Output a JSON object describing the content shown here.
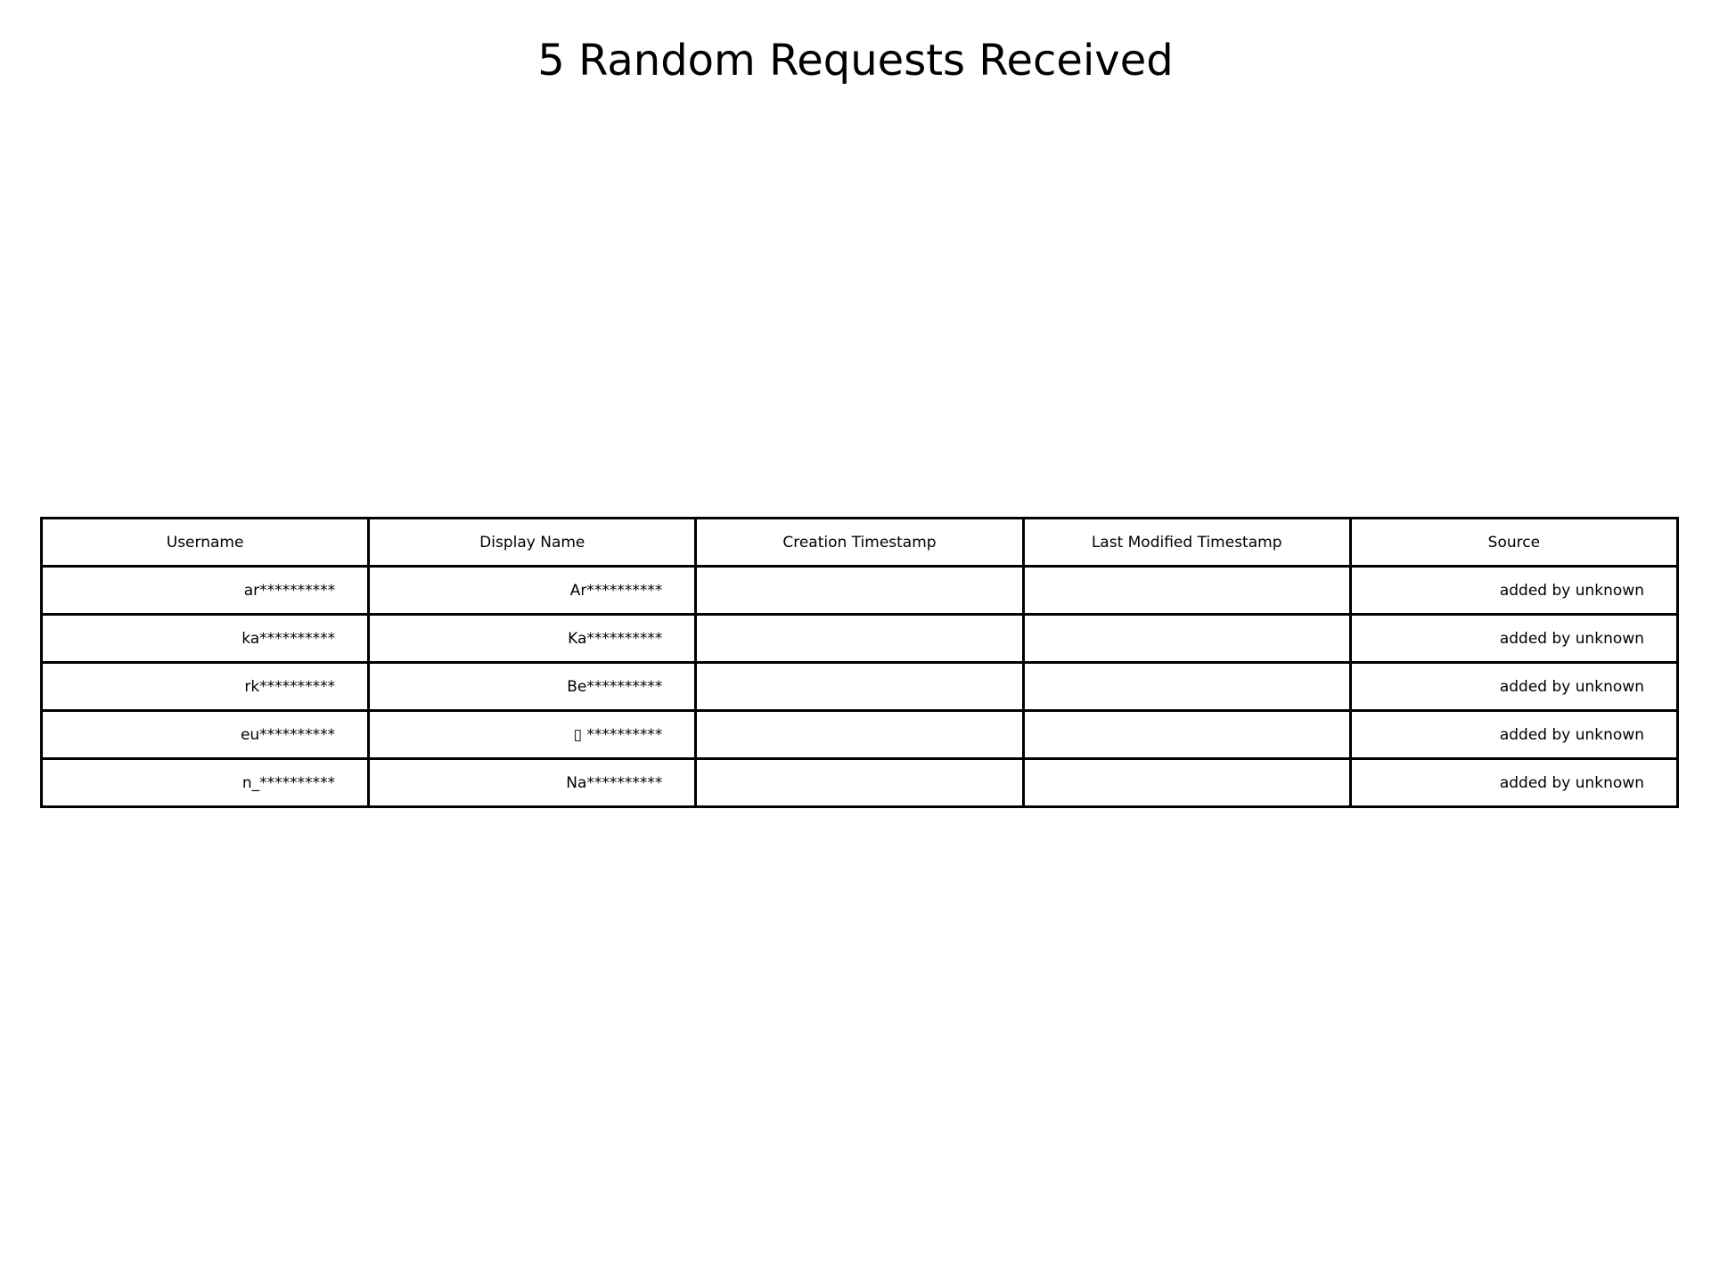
{
  "chart_data": {
    "type": "table",
    "title": "5 Random Requests Received",
    "columns": [
      "Username",
      "Display Name",
      "Creation Timestamp",
      "Last Modified Timestamp",
      "Source"
    ],
    "rows": [
      [
        "ar**********",
        "Ar**********",
        "",
        "",
        "added by unknown"
      ],
      [
        "ka**********",
        "Ka**********",
        "",
        "",
        "added by unknown"
      ],
      [
        "rk**********",
        "Be**********",
        "",
        "",
        "added by unknown"
      ],
      [
        "eu**********",
        "▯ **********",
        "",
        "",
        "added by unknown"
      ],
      [
        "n_**********",
        "Na**********",
        "",
        "",
        "added by unknown"
      ]
    ]
  }
}
